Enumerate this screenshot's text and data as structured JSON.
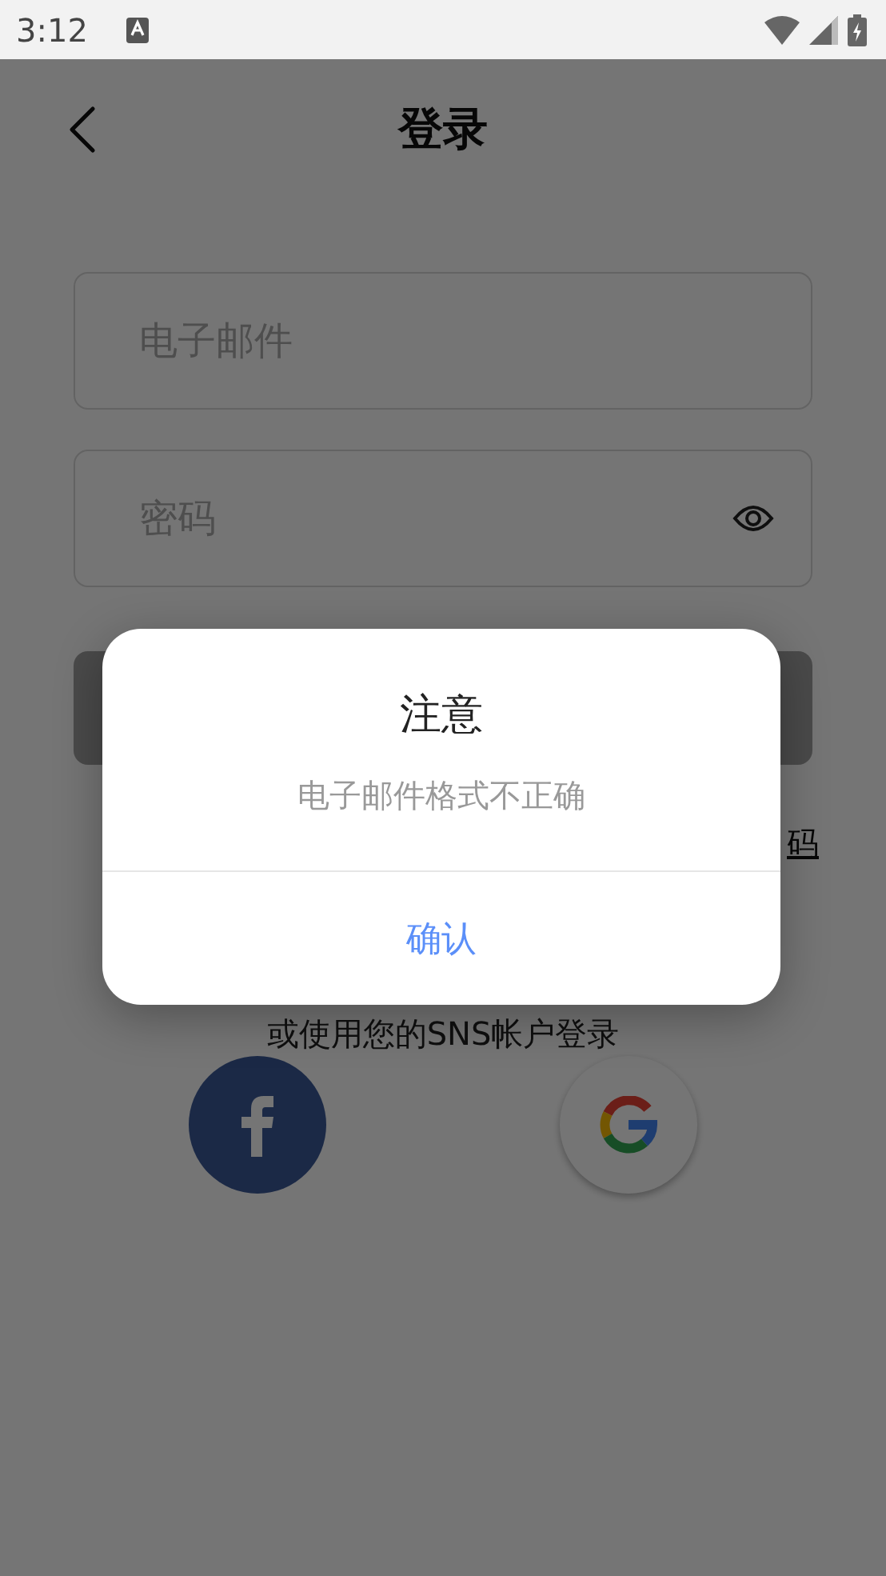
{
  "status_bar": {
    "time": "3:12"
  },
  "header": {
    "title": "登录"
  },
  "fields": [
    {
      "placeholder": "电子邮件",
      "kind": "text"
    },
    {
      "placeholder": "密码",
      "kind": "password"
    }
  ],
  "forgot_link": "码",
  "sns_prompt": "或使用您的SNS帐户登录",
  "sns_buttons": [
    {
      "kind": "facebook"
    },
    {
      "kind": "google"
    }
  ],
  "dialog": {
    "title": "注意",
    "message": "电子邮件格式不正确",
    "button": "确认"
  }
}
